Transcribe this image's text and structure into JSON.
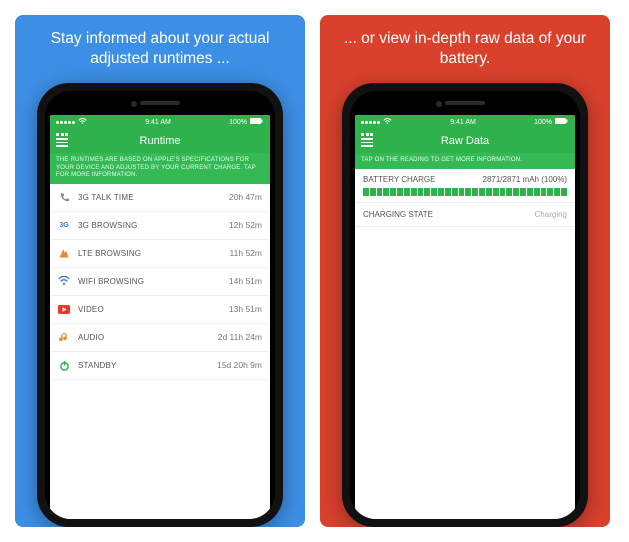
{
  "panels": {
    "left": {
      "tagline": "Stay informed about your actual adjusted runtimes ..."
    },
    "right": {
      "tagline": "... or view in-depth raw data of your battery."
    }
  },
  "status": {
    "carrier_dots": 5,
    "time": "9:41 AM",
    "battery_pct": "100%"
  },
  "runtime": {
    "title": "Runtime",
    "hint": "THE RUNTIMES ARE BASED ON APPLE'S SPECIFICATIONS FOR YOUR DEVICE AND ADJUSTED BY YOUR CURRENT CHARGE. TAP FOR MORE INFORMATION.",
    "rows": [
      {
        "icon": "phone-icon",
        "label": "3G TALK TIME",
        "value": "20h 47m"
      },
      {
        "icon": "3g-icon",
        "label": "3G BROWSING",
        "value": "12h 52m"
      },
      {
        "icon": "lte-icon",
        "label": "LTE BROWSING",
        "value": "11h 52m"
      },
      {
        "icon": "wifi-icon",
        "label": "WIFI BROWSING",
        "value": "14h 51m"
      },
      {
        "icon": "video-icon",
        "label": "VIDEO",
        "value": "13h 51m"
      },
      {
        "icon": "audio-icon",
        "label": "AUDIO",
        "value": "2d 11h 24m"
      },
      {
        "icon": "standby-icon",
        "label": "STANDBY",
        "value": "15d 20h 9m"
      }
    ]
  },
  "raw": {
    "title": "Raw Data",
    "hint": "TAP ON THE READING TO GET MORE INFORMATION.",
    "battery": {
      "label": "BATTERY CHARGE",
      "value": "2871/2871 mAh (100%)"
    },
    "charging": {
      "label": "CHARGING STATE",
      "value": "Charging"
    }
  },
  "colors": {
    "brand_green": "#2fb24c",
    "blue": "#3d8fe6",
    "red": "#d9412d"
  }
}
